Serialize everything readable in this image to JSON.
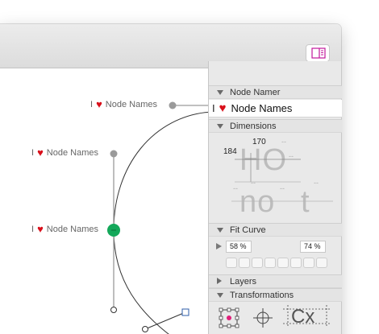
{
  "canvas": {
    "labels": [
      {
        "prefix": "I",
        "text": "Node Names"
      },
      {
        "prefix": "I",
        "text": "Node Names"
      },
      {
        "prefix": "I",
        "text": "Node Names"
      }
    ]
  },
  "panel": {
    "node_namer": {
      "title": "Node Namer",
      "value_prefix": "I",
      "value_text": "Node Names"
    },
    "dimensions": {
      "title": "Dimensions",
      "width_value": "170",
      "height_value": "184",
      "ghost_top": "HO",
      "ghost_bottom_left": "no",
      "ghost_bottom_right": "t",
      "dash": "--"
    },
    "fit_curve": {
      "title": "Fit Curve",
      "min_value": "58 %",
      "max_value": "74 %"
    },
    "layers": {
      "title": "Layers"
    },
    "transformations": {
      "title": "Transformations",
      "icon_text": "Cx"
    }
  },
  "colors": {
    "accent_magenta": "#c2189b",
    "selected_node": "#14a85a",
    "heart": "#d90f1a"
  },
  "icons": {
    "sidebar_toggle": "sidebar-panel-icon",
    "heart": "heart-icon",
    "section_toggle": "disclosure-triangle-icon"
  }
}
